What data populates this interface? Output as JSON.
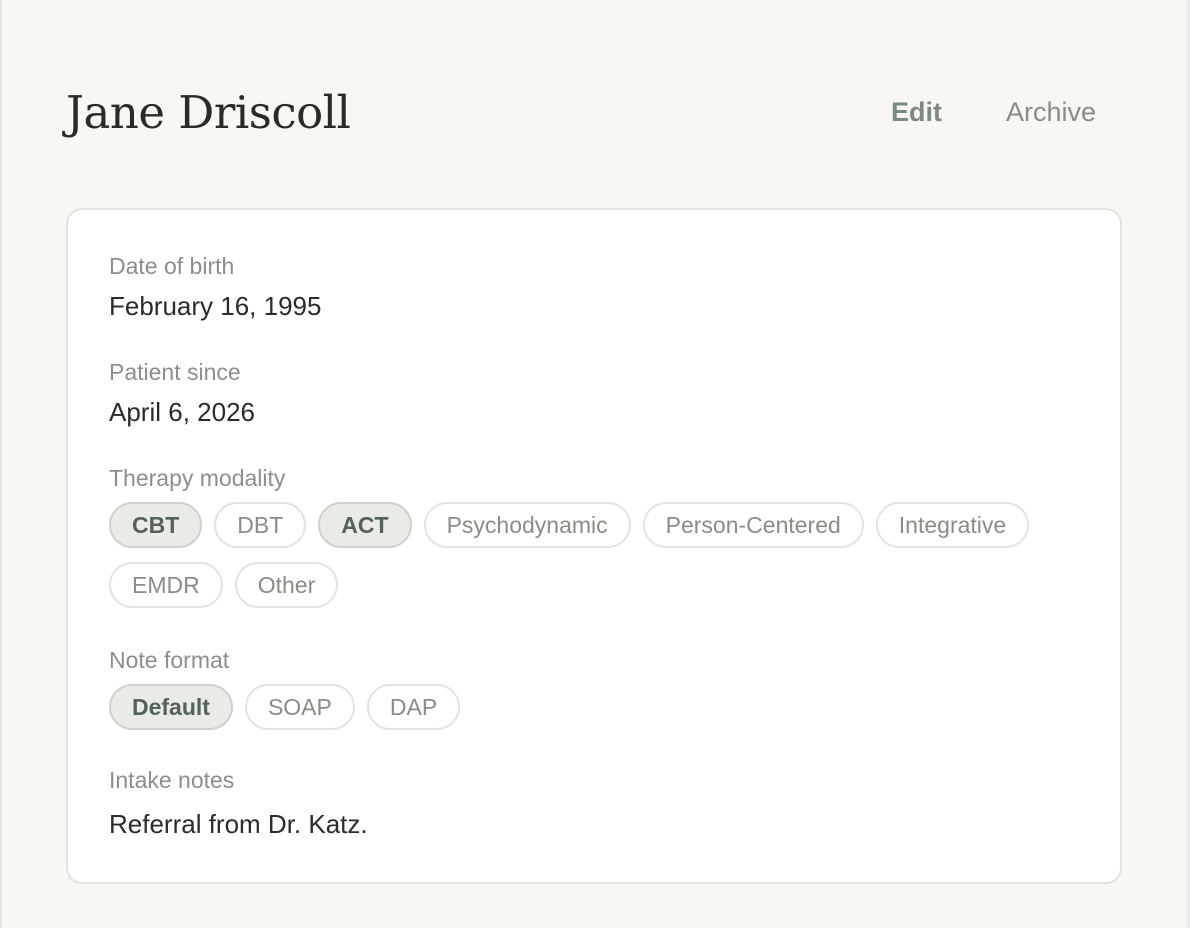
{
  "patient": {
    "name": "Jane Driscoll"
  },
  "actions": {
    "edit_label": "Edit",
    "archive_label": "Archive"
  },
  "fields": {
    "dob": {
      "label": "Date of birth",
      "value": "February 16, 1995"
    },
    "patient_since": {
      "label": "Patient since",
      "value": "April 6, 2026"
    },
    "therapy_modality": {
      "label": "Therapy modality",
      "options": [
        {
          "label": "CBT",
          "selected": true
        },
        {
          "label": "DBT",
          "selected": false
        },
        {
          "label": "ACT",
          "selected": true
        },
        {
          "label": "Psychodynamic",
          "selected": false
        },
        {
          "label": "Person-Centered",
          "selected": false
        },
        {
          "label": "Integrative",
          "selected": false
        },
        {
          "label": "EMDR",
          "selected": false
        },
        {
          "label": "Other",
          "selected": false
        }
      ]
    },
    "note_format": {
      "label": "Note format",
      "options": [
        {
          "label": "Default",
          "selected": true
        },
        {
          "label": "SOAP",
          "selected": false
        },
        {
          "label": "DAP",
          "selected": false
        }
      ]
    },
    "intake_notes": {
      "label": "Intake notes",
      "value": "Referral from Dr. Katz."
    }
  },
  "colors": {
    "background": "#f8f7f3",
    "card": "#ffffff",
    "accent": "#7c8a7d",
    "selected_pill_bg": "#e8ebe6"
  }
}
